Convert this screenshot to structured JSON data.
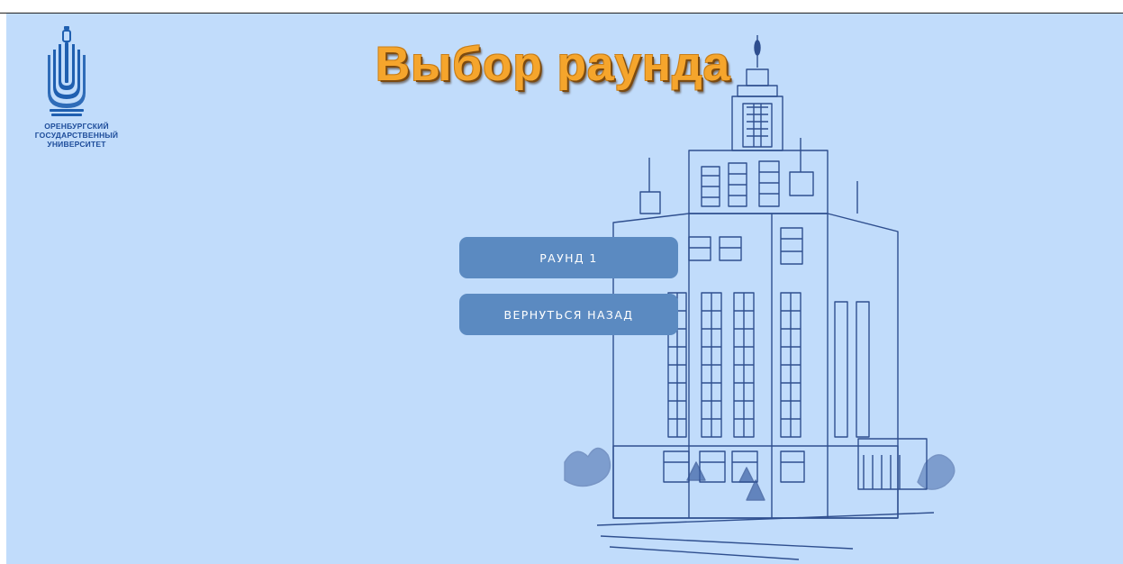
{
  "page": {
    "title": "Выбор раунда",
    "background_color": "#c1dcfb",
    "title_color": "#f5a52c"
  },
  "logo": {
    "icon": "university-emblem-icon",
    "text_lines": [
      "ОРЕНБУРГСКИЙ",
      "ГОСУДАРСТВЕННЫЙ",
      "УНИВЕРСИТЕТ"
    ]
  },
  "menu": {
    "round1_label": "РАУНД 1",
    "back_label": "ВЕРНУТЬСЯ НАЗАД",
    "button_color": "#5b8ac1"
  },
  "illustration": {
    "icon": "university-building-illustration"
  }
}
